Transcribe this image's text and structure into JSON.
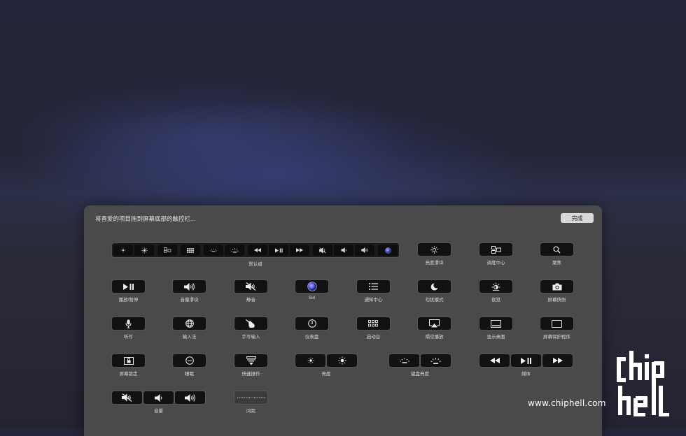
{
  "panel": {
    "instruction": "将喜爱的项目拖到屏幕底部的触控栏...",
    "done_label": "完成"
  },
  "row1": {
    "default_group_label": "默认组",
    "brightness_slider_label": "亮度滑块",
    "mission_control_label": "调度中心",
    "spotlight_label": "聚焦"
  },
  "row2": {
    "play_pause_label": "播放/暂停",
    "volume_slider_label": "音量滑块",
    "mute_label": "静音",
    "siri_label": "Siri",
    "notification_center_label": "通知中心",
    "do_not_disturb_label": "勿扰模式",
    "night_shift_label": "夜览",
    "screenshot_label": "屏幕快照"
  },
  "row3": {
    "dictation_label": "听写",
    "input_source_label": "输入法",
    "handwriting_label": "手写输入",
    "dashboard_label": "仪表盘",
    "launchpad_label": "启动台",
    "airplay_label": "隔空播放",
    "show_desktop_label": "显示桌面",
    "screen_saver_label": "屏幕保护程序"
  },
  "row4": {
    "screen_lock_label": "屏幕锁定",
    "sleep_label": "睡眠",
    "quick_actions_label": "快速操作",
    "brightness_label": "亮度",
    "keyboard_brightness_label": "键盘亮度",
    "media_label": "媒体"
  },
  "row5": {
    "volume_label": "音量",
    "space_label": "间距"
  },
  "watermark": {
    "url": "www.chiphell.com",
    "logo_text": "chip hell"
  },
  "icons": {
    "brightness": "sun-icon",
    "mission_control": "mission-control-icon",
    "spotlight": "magnifier-icon",
    "play_pause": "play-pause-icon",
    "volume": "speaker-icon",
    "mute": "speaker-muted-icon",
    "siri": "siri-icon",
    "notification": "list-icon",
    "dnd": "moon-icon",
    "night_shift": "night-shift-icon",
    "screenshot": "camera-icon",
    "dictation": "microphone-icon",
    "input_source": "globe-icon",
    "handwriting": "hand-pen-icon",
    "dashboard": "gauge-icon",
    "launchpad": "grid-icon",
    "airplay": "airplay-icon",
    "show_desktop": "desktop-icon",
    "screen_saver": "screen-icon",
    "lock": "lock-icon",
    "sleep": "sleep-icon",
    "quick_actions": "quick-actions-icon"
  }
}
